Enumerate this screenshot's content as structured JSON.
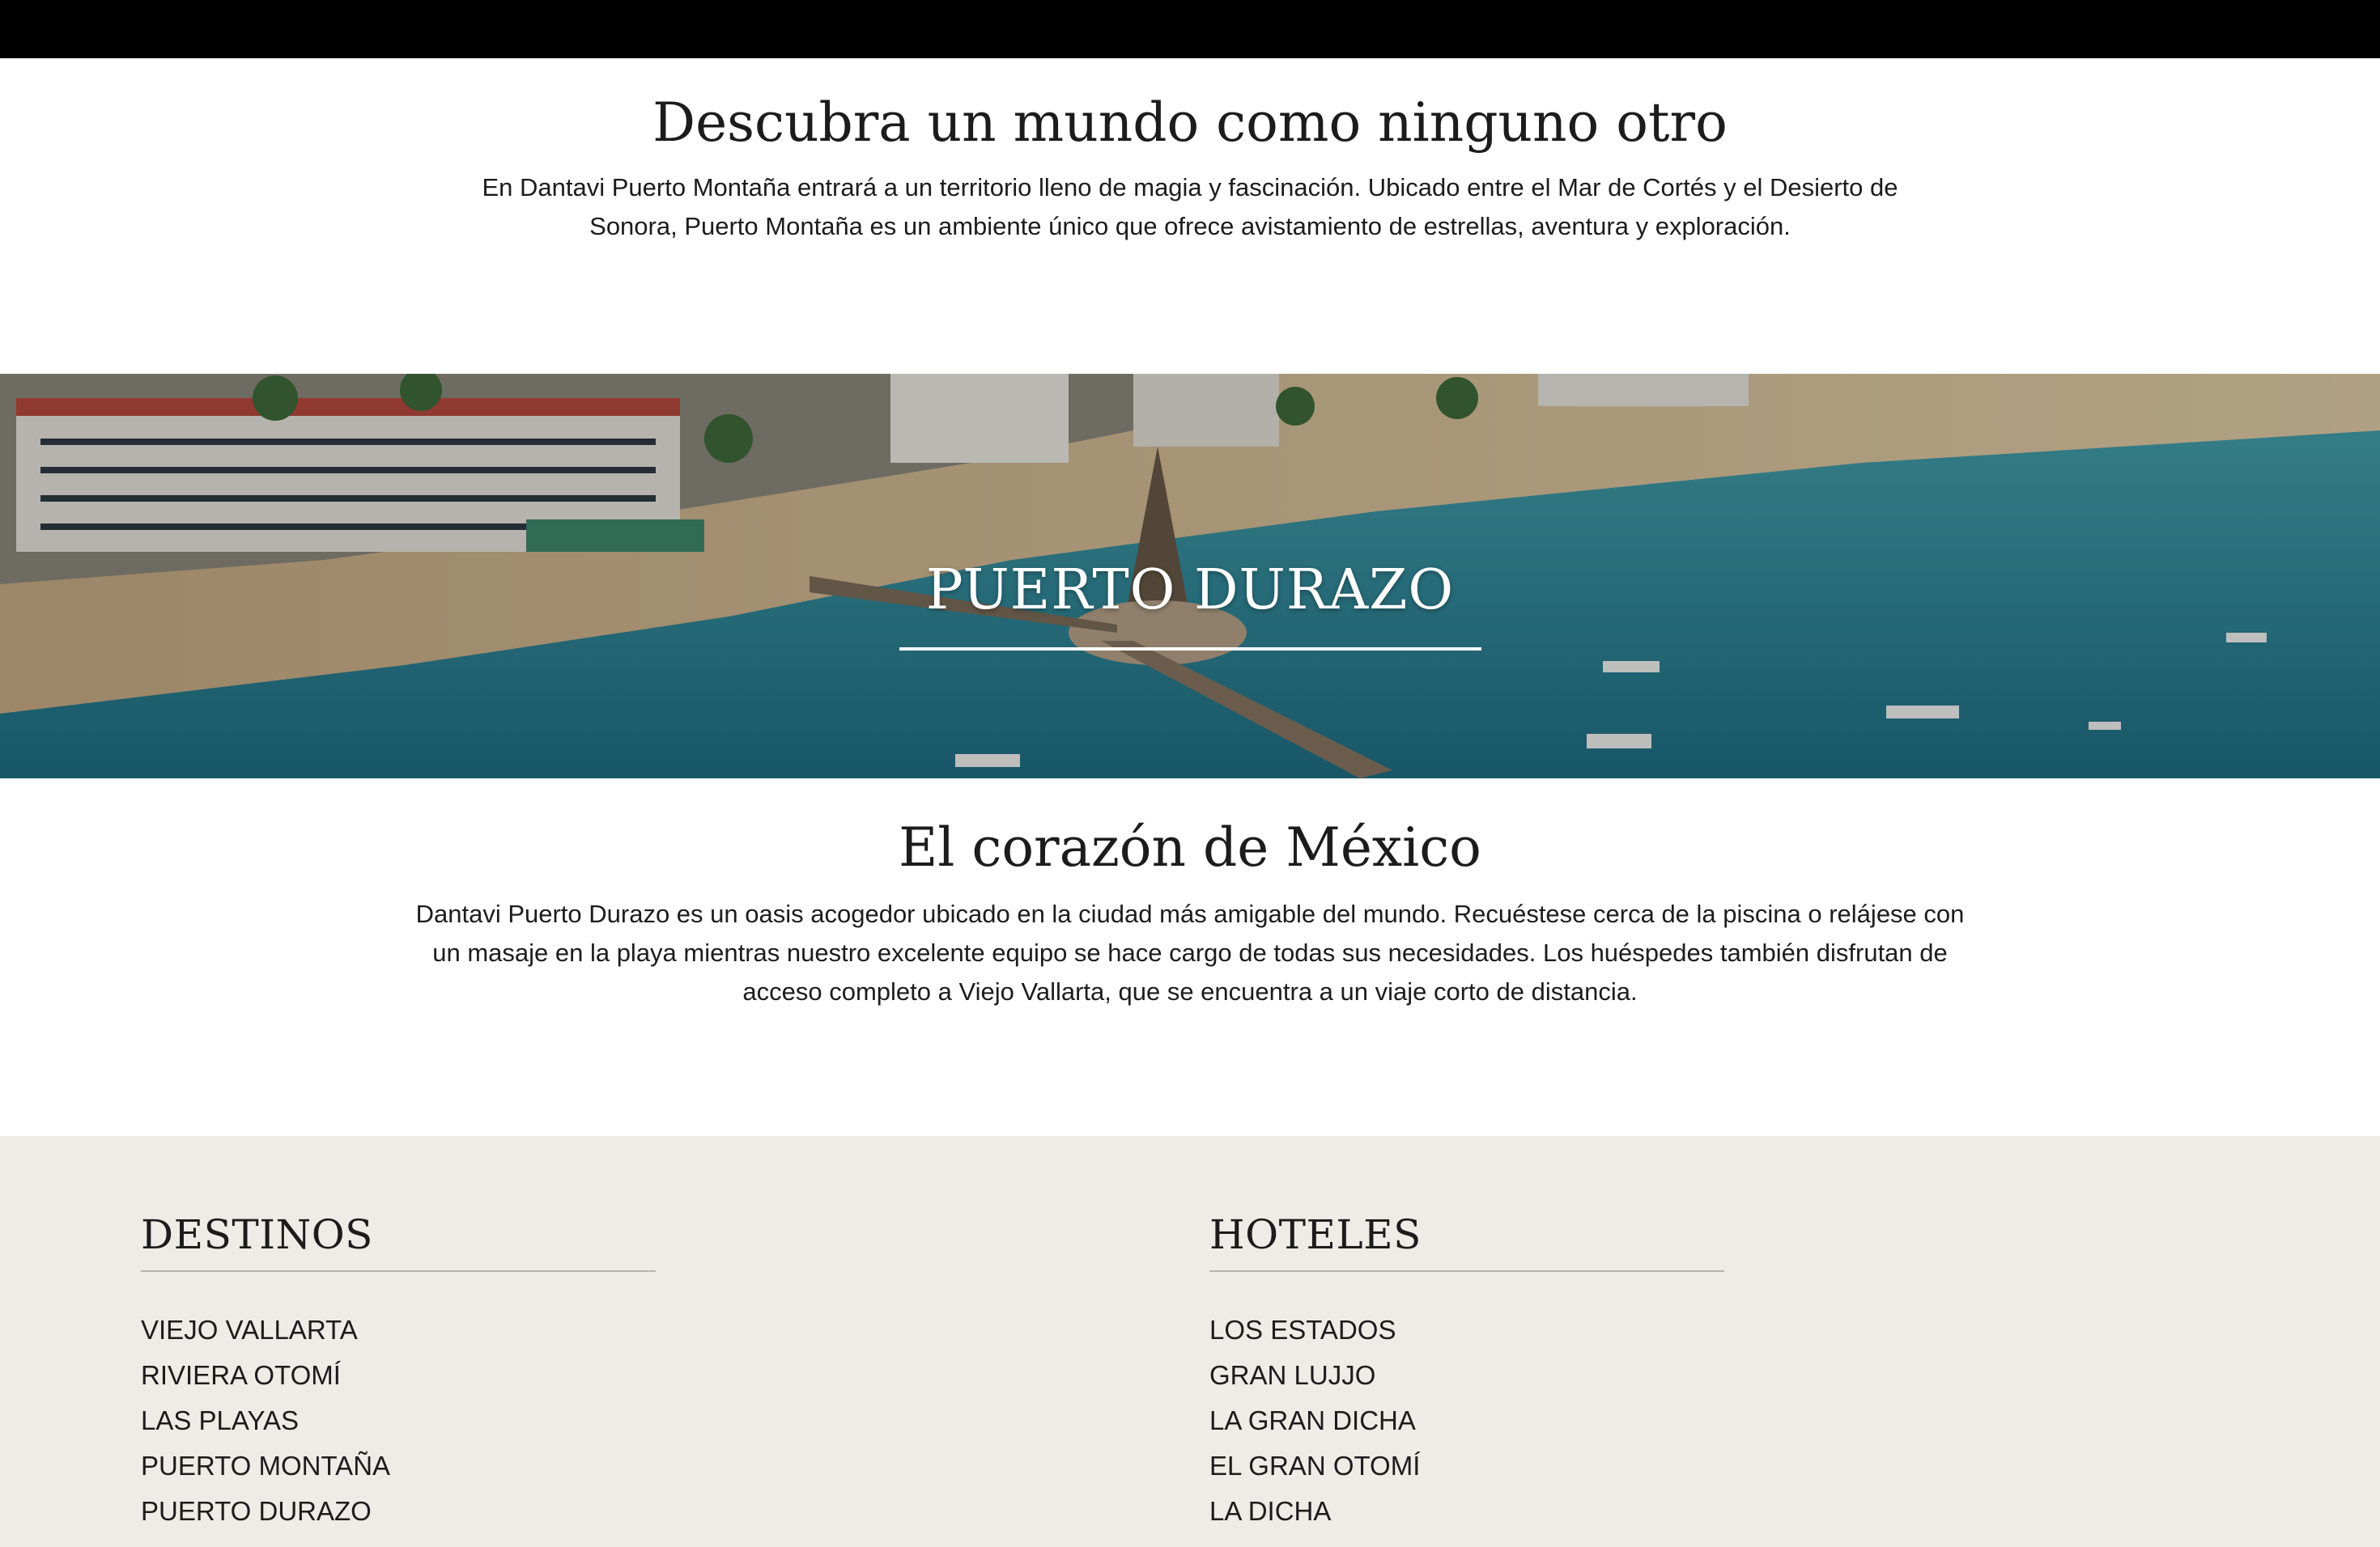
{
  "intro": {
    "title": "Descubra un mundo como ninguno otro",
    "body": "En Dantavi Puerto Montaña entrará a un territorio lleno de magia y fascinación. Ubicado entre el Mar de Cortés y el Desierto de Sonora, Puerto Montaña es un ambiente único que ofrece avistamiento de estrellas, aventura y exploración."
  },
  "hero": {
    "title": "PUERTO DURAZO"
  },
  "section": {
    "title": "El corazón de México",
    "body": "Dantavi Puerto Durazo es un oasis acogedor ubicado en la ciudad más amigable del mundo. Recuéstese cerca de la piscina o relájese con un masaje en la playa mientras nuestro excelente equipo se hace cargo de todas sus necesidades. Los huéspedes también disfrutan de acceso completo a Viejo Vallarta, que se encuentra a un viaje corto de distancia."
  },
  "footer": {
    "destinos": {
      "heading": "DESTINOS",
      "items": [
        "VIEJO VALLARTA",
        "RIVIERA OTOMÍ",
        "LAS PLAYAS",
        "PUERTO MONTAÑA",
        "PUERTO DURAZO"
      ]
    },
    "hoteles": {
      "heading": "HOTELES",
      "items": [
        "LOS ESTADOS",
        "GRAN LUJJO",
        "LA GRAN DICHA",
        "EL GRAN OTOMÍ",
        "LA DICHA"
      ]
    }
  },
  "colors": {
    "topbar": "#000000",
    "footer_bg": "#eeece7",
    "text": "#1c1c1c",
    "sea": "#2f8fa0",
    "sand": "#d9c3a0"
  }
}
